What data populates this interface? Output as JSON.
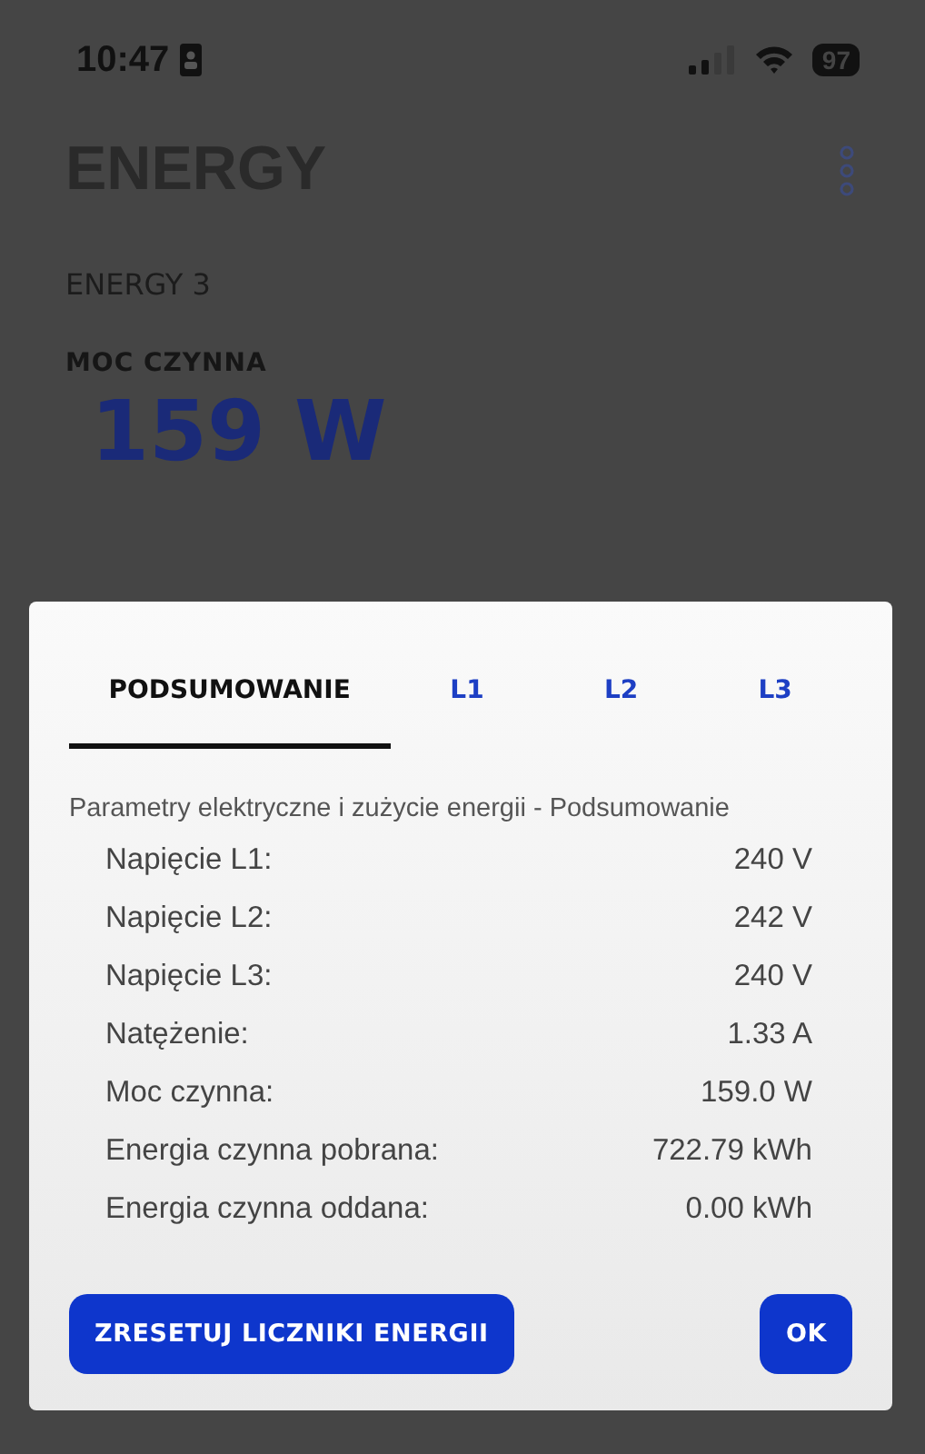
{
  "status_bar": {
    "time": "10:47",
    "battery": "97"
  },
  "header": {
    "title": "ENERGY"
  },
  "device": {
    "name": "ENERGY 3",
    "metric_label": "MOC CZYNNA",
    "metric_value": "159 W"
  },
  "dialog": {
    "tabs": [
      {
        "label": "PODSUMOWANIE",
        "selected": true
      },
      {
        "label": "L1",
        "selected": false
      },
      {
        "label": "L2",
        "selected": false
      },
      {
        "label": "L3",
        "selected": false
      }
    ],
    "description": "Parametry elektryczne i zużycie energii - Podsumowanie",
    "rows": [
      {
        "label": "Napięcie L1:",
        "value": "240 V"
      },
      {
        "label": "Napięcie L2:",
        "value": "242 V"
      },
      {
        "label": "Napięcie L3:",
        "value": "240 V"
      },
      {
        "label": "Natężenie:",
        "value": "1.33 A"
      },
      {
        "label": "Moc czynna:",
        "value": "159.0 W"
      },
      {
        "label": "Energia czynna pobrana:",
        "value": "722.79 kWh"
      },
      {
        "label": "Energia czynna oddana:",
        "value": "0.00 kWh"
      }
    ],
    "buttons": [
      {
        "label": "ZRESETUJ LICZNIKI ENERGII"
      },
      {
        "label": "OK"
      }
    ]
  }
}
